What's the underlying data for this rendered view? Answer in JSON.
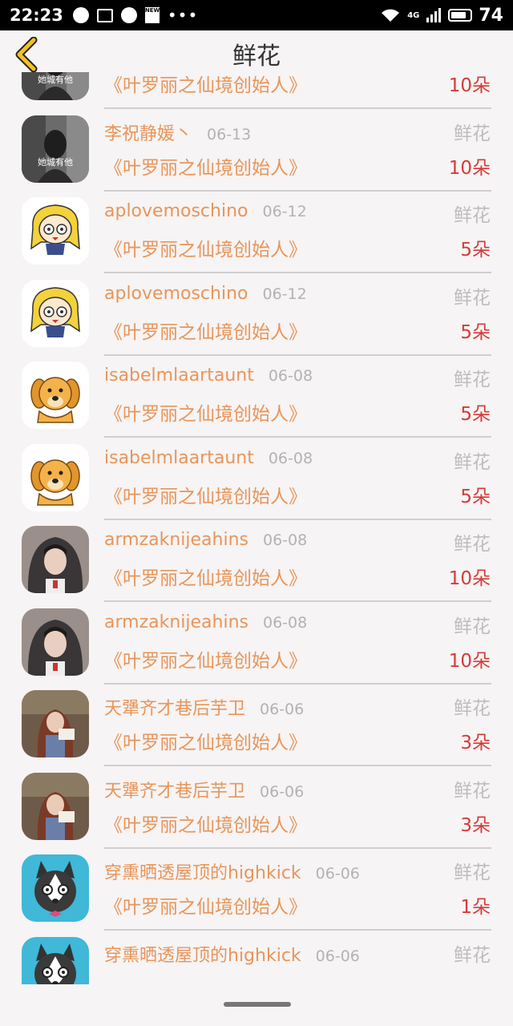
{
  "status_bar": {
    "time": "22:23",
    "network": "4G",
    "battery_level": "74",
    "icons": [
      "chat-bubble-icon",
      "image-icon",
      "message-icon",
      "news-icon",
      "more-dots-icon",
      "wifi-icon",
      "signal-icon",
      "battery-icon"
    ]
  },
  "nav": {
    "title": "鲜花",
    "back_icon": "chevron-left-icon",
    "accent_color": "#f4c21f"
  },
  "colors": {
    "username": "#e8955a",
    "date": "#b3b3b3",
    "count": "#d63a3a",
    "gift_type": "#bdbdbd"
  },
  "rows": [
    {
      "avatar": "bw-photo-avatar",
      "avatar_text": "她城有他",
      "name": "",
      "date": "",
      "type": "",
      "book": "《叶罗丽之仙境创始人》",
      "count": "10朵"
    },
    {
      "avatar": "bw-photo-avatar",
      "avatar_text": "她城有他",
      "name": "李祝静媛丶",
      "date": "06-13",
      "type": "鲜花",
      "book": "《叶罗丽之仙境创始人》",
      "count": "10朵"
    },
    {
      "avatar": "cartoon-girl-avatar",
      "name": "aplovemoschino",
      "date": "06-12",
      "type": "鲜花",
      "book": "《叶罗丽之仙境创始人》",
      "count": "5朵"
    },
    {
      "avatar": "cartoon-girl-avatar",
      "name": "aplovemoschino",
      "date": "06-12",
      "type": "鲜花",
      "book": "《叶罗丽之仙境创始人》",
      "count": "5朵"
    },
    {
      "avatar": "cartoon-dog-avatar",
      "name": "isabelmlaartaunt",
      "date": "06-08",
      "type": "鲜花",
      "book": "《叶罗丽之仙境创始人》",
      "count": "5朵"
    },
    {
      "avatar": "cartoon-dog-avatar",
      "name": "isabelmlaartaunt",
      "date": "06-08",
      "type": "鲜花",
      "book": "《叶罗丽之仙境创始人》",
      "count": "5朵"
    },
    {
      "avatar": "hooded-person-avatar",
      "name": "armzaknijeahins",
      "date": "06-08",
      "type": "鲜花",
      "book": "《叶罗丽之仙境创始人》",
      "count": "10朵"
    },
    {
      "avatar": "hooded-person-avatar",
      "name": "armzaknijeahins",
      "date": "06-08",
      "type": "鲜花",
      "book": "《叶罗丽之仙境创始人》",
      "count": "10朵"
    },
    {
      "avatar": "reading-girl-avatar",
      "name": "天犟齐才巷后芋卫",
      "date": "06-06",
      "type": "鲜花",
      "book": "《叶罗丽之仙境创始人》",
      "count": "3朵"
    },
    {
      "avatar": "reading-girl-avatar",
      "name": "天犟齐才巷后芋卫",
      "date": "06-06",
      "type": "鲜花",
      "book": "《叶罗丽之仙境创始人》",
      "count": "3朵"
    },
    {
      "avatar": "husky-avatar",
      "name": "穿熏晒透屋顶的highkick",
      "date": "06-06",
      "type": "鲜花",
      "book": "《叶罗丽之仙境创始人》",
      "count": "1朵"
    },
    {
      "avatar": "husky-avatar",
      "name": "穿熏晒透屋顶的highkick",
      "date": "06-06",
      "type": "鲜花",
      "book": "",
      "count": ""
    }
  ]
}
